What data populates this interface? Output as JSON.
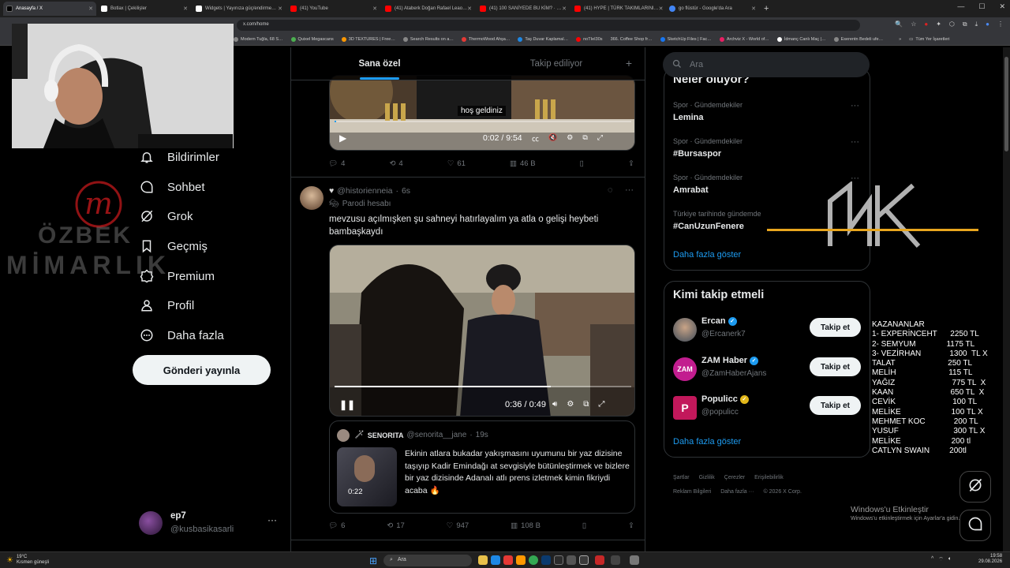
{
  "browser": {
    "tabs": [
      {
        "label": "Anasayfa / X",
        "color": "#000000",
        "active": true
      },
      {
        "label": "Botlax | Çekilişler",
        "color": "#ffffff"
      },
      {
        "label": "Widgets | Yayınıza güç/endirme…",
        "color": "#ffffff"
      },
      {
        "label": "(41) YouTube",
        "color": "#ff0000"
      },
      {
        "label": "(41) Ataberk Doğan Rafael Leao…",
        "color": "#ff0000"
      },
      {
        "label": "(41) 100 SANİYEDE BU KİM? · …",
        "color": "#ff0000"
      },
      {
        "label": "(41) HYPE | TÜRK TAKIMLARINI…",
        "color": "#ff0000"
      },
      {
        "label": "go flüstür - Google'da Ara",
        "color": "#4285f4"
      }
    ],
    "new_tab": "+",
    "address": "x.com/home",
    "bookmarks": [
      "Modern Tuğla, 68 S…",
      "Quixel Megascans",
      "3D TEXTURES | Free…",
      "Search Results on a…",
      "ThermoWood Ahşa…",
      "Taş Duvar Kaplamal…",
      "noTIeI30s",
      "366. Coffee Shop fr…",
      "SketchUp Files | Fac…",
      "Archviz X - World of…",
      "İdmanç Canlı Maç |…",
      "Eserentn Bedeli ufe…"
    ],
    "bookmarks_all": "Tüm Yer İşaretleri"
  },
  "nav": {
    "items": [
      {
        "label": "Bildirimler",
        "icon": "bell-icon"
      },
      {
        "label": "Sohbet",
        "icon": "chat-icon"
      },
      {
        "label": "Grok",
        "icon": "grok-icon"
      },
      {
        "label": "Geçmiş",
        "icon": "bookmark-icon"
      },
      {
        "label": "Premium",
        "icon": "premium-icon"
      },
      {
        "label": "Profil",
        "icon": "profile-icon"
      },
      {
        "label": "Daha fazla",
        "icon": "more-icon"
      }
    ],
    "post_button": "Gönderi yayınla",
    "account": {
      "name": "ep7",
      "handle": "@kusbasikasarli",
      "more": "···"
    }
  },
  "watermark": {
    "line1": "ÖZBEK",
    "line2": "MİMARLIK"
  },
  "feed": {
    "tabs": [
      "Sana özel",
      "Takip ediliyor"
    ],
    "add": "+",
    "post1": {
      "subtitle": "hoş geldiniz",
      "time": "0:02 / 9:54",
      "progress": 0.004,
      "stats": {
        "replies": "4",
        "reposts": "4",
        "likes": "61",
        "views": "46 B"
      }
    },
    "post2": {
      "handle": "@historienneia",
      "time": "6s",
      "badge": "Parodi hesabı",
      "text": "mevzusu açılmışken şu sahneyi hatırlayalım ya atla o gelişi heybeti bambaşkaydı",
      "video_time": "0:36 / 0:49",
      "progress": 0.73,
      "quote": {
        "name": "SENORITA",
        "handle": "@senorita__jane",
        "time": "19s",
        "text": "Ekinin atlara bukadar yakışmasını uyumunu bir yaz dizisine taşıyıp Kadir Emindağı at sevgisiyle bütünleştirmek ve bizlere bir yaz dizisinde Adanalı atlı prens izletmek kimin fikriydi acaba 🔥",
        "thumb_time": "0:22"
      },
      "stats": {
        "replies": "6",
        "reposts": "17",
        "likes": "947",
        "views": "108 B"
      }
    }
  },
  "sidebar": {
    "search_placeholder": "Ara",
    "trends_title": "Neler oluyor?",
    "trends": [
      {
        "category": "Spor · Gündemdekiler",
        "name": "Lemina"
      },
      {
        "category": "Spor · Gündemdekiler",
        "name": "#Bursaspor"
      },
      {
        "category": "Spor · Gündemdekiler",
        "name": "Amrabat"
      },
      {
        "category": "Türkiye tarihinde gündemde",
        "name": "#CanUzunFenere"
      }
    ],
    "trends_more": "Daha fazla göster",
    "who_title": "Kimi takip etmeli",
    "who": [
      {
        "name": "Ercan",
        "handle": "@Ercanerk7",
        "badge": "blue",
        "color": "#5a6b7a"
      },
      {
        "name": "ZAM Haber",
        "handle": "@ZamHaberAjans",
        "badge": "blue",
        "color": "#c21d8f",
        "mono": "ZAM"
      },
      {
        "name": "Populicc",
        "handle": "@populicc",
        "badge": "gold",
        "color": "#c2185b",
        "mono": "P"
      }
    ],
    "follow_label": "Takip et",
    "who_more": "Daha fazla göster",
    "footer": [
      "Şartlar",
      "Gizlilik",
      "Çerezler",
      "Erişilebilirlik",
      "Reklam Bilgileri",
      "Daha fazla ···",
      "© 2026 X Corp."
    ]
  },
  "kazananlar": "KAZANANLAR\n1- EXPERİNCEHT      2250 TL\n2- SEMYUM              1175 TL\n3- VEZİRHAN             1300  TL X\nTALAT                        250 TL\nMELİH                        115 TL\nYAĞIZ                          775 TL  X\nKAAN                          650 TL  X\nCEVİK                          100 TL\nMELİKE                       100 TL X\nMEHMET KOC             200 TL\nYUSUF                         300 TL X\nMELİKE                       200 tl\nCATLYN SWAIN         200tl",
  "windows": {
    "activate_title": "Windows'u Etkinleştir",
    "activate_sub": "Windows'u etkinleştirmek için Ayarlar'a gidin.",
    "weather_temp": "19°C",
    "weather_desc": "Kısmen güneşli",
    "search": "Ara",
    "clock_time": "19:58",
    "clock_date": "29.08.2026"
  },
  "colors": {
    "accent": "#1d9bf0",
    "link": "#1d9bf0",
    "trend_more": "#1d9bf0"
  }
}
